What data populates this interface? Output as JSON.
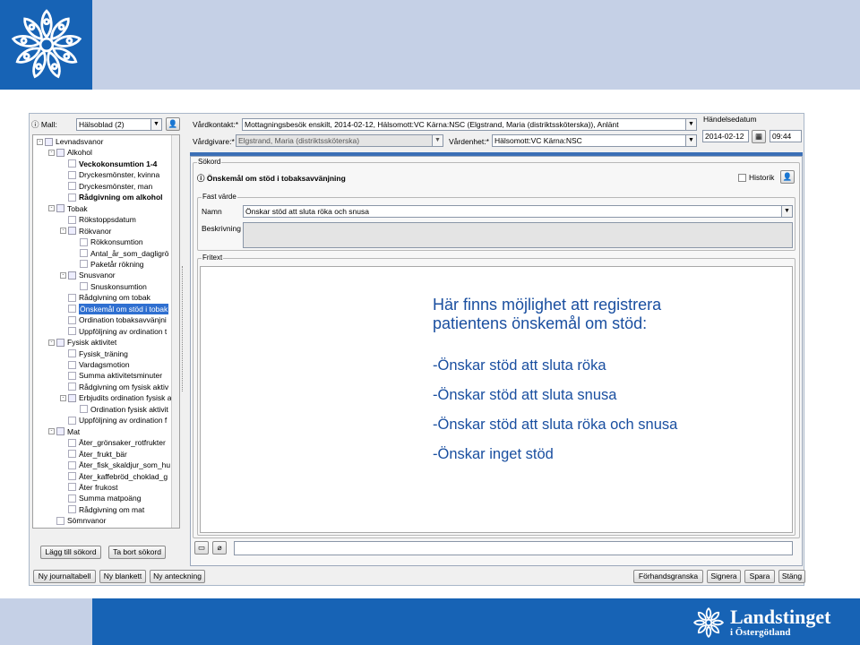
{
  "app": {
    "mall_label": "Mall:",
    "mall_value": "Hälsoblad (2)",
    "vardkontakt_label": "Vårdkontakt:*",
    "vardkontakt_value": "Mottagningsbesök enskilt, 2014-02-12, Hälsomott:VC Kärna:NSC (Elgstrand, Maria (distriktssköterska)), Anlänt",
    "vardgivare_label": "Vårdgivare:*",
    "vardgivare_value": "Elgstrand, Maria (distriktssköterska)",
    "vardenhet_label": "Vårdenhet:*",
    "vardenhet_value": "Hälsomott:VC Kärna:NSC",
    "handelsedatum_label": "Händelsedatum",
    "date_value": "2014-02-12",
    "time_value": "09:44",
    "sokord_group": "Sökord",
    "sokord_title": "Önskemål om stöd i tobaksavvänjning",
    "historik_label": "Historik",
    "fast_varde_group": "Fast värde",
    "namn_label": "Namn",
    "namn_value": "Önskar stöd att sluta röka och snusa",
    "beskrivning_label": "Beskrivning",
    "fritext_group": "Fritext",
    "btn_lagg_till": "Lägg till sökord",
    "btn_ta_bort": "Ta bort sökord",
    "btn_ny_journaltabell": "Ny journaltabell",
    "btn_ny_blankett": "Ny blankett",
    "btn_ny_anteckning": "Ny anteckning",
    "btn_forhandsgranska": "Förhandsgranska",
    "btn_signera": "Signera",
    "btn_spara": "Spara",
    "btn_stang": "Stäng"
  },
  "tree": [
    {
      "label": "Levnadsvanor",
      "depth": 0,
      "toggle": "-"
    },
    {
      "label": "Alkohol",
      "depth": 1,
      "toggle": "-"
    },
    {
      "label": "Veckokonsumtion   1-4",
      "depth": 2,
      "bold": true
    },
    {
      "label": "Dryckesmönster, kvinna",
      "depth": 2
    },
    {
      "label": "Dryckesmönster, man",
      "depth": 2
    },
    {
      "label": "Rådgivning om alkohol",
      "depth": 2,
      "bold": true
    },
    {
      "label": "Tobak",
      "depth": 1,
      "toggle": "-"
    },
    {
      "label": "Rökstoppsdatum",
      "depth": 2
    },
    {
      "label": "Rökvanor",
      "depth": 2,
      "toggle": "-"
    },
    {
      "label": "Rökkonsumtion",
      "depth": 3
    },
    {
      "label": "Antal_år_som_dagligrö",
      "depth": 3
    },
    {
      "label": "Paketår rökning",
      "depth": 3
    },
    {
      "label": "Snusvanor",
      "depth": 2,
      "toggle": "-"
    },
    {
      "label": "Snuskonsumtion",
      "depth": 3
    },
    {
      "label": "Rådgivning om tobak",
      "depth": 2
    },
    {
      "label": "Önskemål om stöd i tobak",
      "depth": 2,
      "selected": true
    },
    {
      "label": "Ordination tobaksavvänjni",
      "depth": 2
    },
    {
      "label": "Uppföljning av ordination t",
      "depth": 2
    },
    {
      "label": "Fysisk aktivitet",
      "depth": 1,
      "toggle": "-"
    },
    {
      "label": "Fysisk_träning",
      "depth": 2
    },
    {
      "label": "Vardagsmotion",
      "depth": 2
    },
    {
      "label": "Summa aktivitetsminuter",
      "depth": 2
    },
    {
      "label": "Rådgivning om fysisk aktiv",
      "depth": 2
    },
    {
      "label": "Erbjudits ordination fysisk a",
      "depth": 2,
      "toggle": "-"
    },
    {
      "label": "Ordination fysisk aktivit",
      "depth": 3
    },
    {
      "label": "Uppföljning av ordination f",
      "depth": 2
    },
    {
      "label": "Mat",
      "depth": 1,
      "toggle": "-"
    },
    {
      "label": "Äter_grönsaker_rotfrukter",
      "depth": 2
    },
    {
      "label": "Äter_frukt_bär",
      "depth": 2
    },
    {
      "label": "Äter_fisk_skaldjur_som_hu",
      "depth": 2
    },
    {
      "label": "Äter_kaffebröd_choklad_g",
      "depth": 2
    },
    {
      "label": "Äter frukost",
      "depth": 2
    },
    {
      "label": "Summa matpoäng",
      "depth": 2
    },
    {
      "label": "Rådgivning om mat",
      "depth": 2
    },
    {
      "label": "Sömnvanor",
      "depth": 1
    }
  ],
  "slide": {
    "line1": "Här finns möjlighet att registrera",
    "line2": "patientens önskemål om stöd:",
    "items": [
      "-Önskar stöd att sluta röka",
      "-Önskar stöd att sluta snusa",
      "-Önskar stöd att sluta röka och snusa",
      "-Önskar inget stöd"
    ]
  },
  "brand": {
    "name": "Landstinget",
    "sub": "i Östergötland"
  },
  "colors": {
    "brand_blue": "#1763b5",
    "light_blue": "#c5d0e6",
    "slide_text": "#1a4fa0"
  }
}
